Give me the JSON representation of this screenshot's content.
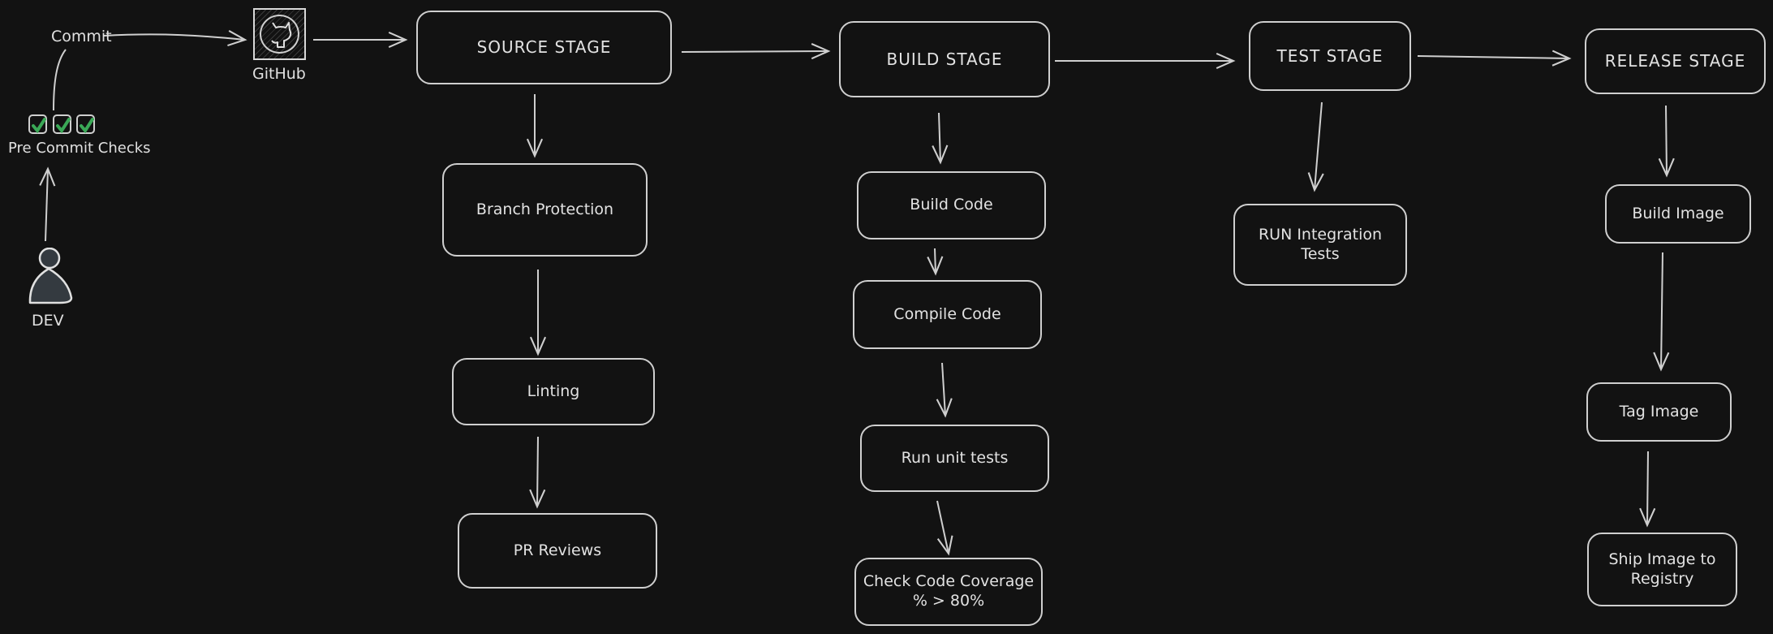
{
  "colors": {
    "background": "#121212",
    "stroke": "#cfcfcf",
    "text": "#e2e2e2",
    "check_green": "#3aa856",
    "person_fill": "#343a40"
  },
  "left": {
    "commit_label": "Commit",
    "github": {
      "icon": "github-icon",
      "label": "GitHub"
    },
    "pre_commit": {
      "icon": "checkbox-checked-icon",
      "count": 3,
      "label": "Pre Commit Checks"
    },
    "dev": {
      "icon": "person-icon",
      "label": "DEV"
    }
  },
  "stages": [
    {
      "title": "SOURCE STAGE",
      "steps": [
        "Branch Protection",
        "Linting",
        "PR Reviews"
      ]
    },
    {
      "title": "BUILD STAGE",
      "steps": [
        "Build Code",
        "Compile Code",
        "Run unit tests",
        "Check Code Coverage\n% > 80%"
      ]
    },
    {
      "title": "TEST STAGE",
      "steps": [
        "RUN Integration\nTests"
      ]
    },
    {
      "title": "RELEASE STAGE",
      "steps": [
        "Build Image",
        "Tag Image",
        "Ship Image to\nRegistry"
      ]
    }
  ]
}
